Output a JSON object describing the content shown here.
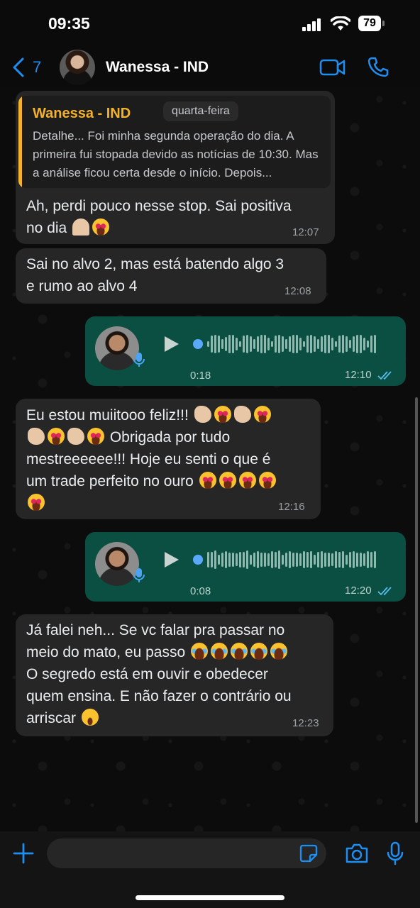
{
  "status_bar": {
    "time": "09:35",
    "battery": "79"
  },
  "header": {
    "back_count": "7",
    "contact_name": "Wanessa - IND"
  },
  "date_separator": "quarta-feira",
  "messages": [
    {
      "direction": "incoming",
      "reply_to": {
        "name": "Wanessa - IND",
        "text": "Detalhe... Foi minha segunda operação do dia. A primeira fui stopada devido as notícias de 10:30. Mas a análise ficou certa desde o início. Depois..."
      },
      "text_lines": [
        "Ah, perdi pouco nesse stop. Sai positiva",
        "no dia"
      ],
      "time": "12:07"
    },
    {
      "direction": "incoming",
      "text_lines": [
        "Sai no alvo 2, mas está batendo algo 3",
        "e rumo ao alvo 4"
      ],
      "time": "12:08"
    },
    {
      "direction": "outgoing",
      "type": "voice",
      "duration": "0:18",
      "time": "12:10",
      "status": "read"
    },
    {
      "direction": "incoming",
      "text_lines": [
        "Eu estou muiitooo feliz!!!",
        "Obrigada por tudo",
        "mestreeeeee!!! Hoje eu senti o que é",
        "um trade perfeito no ouro"
      ],
      "time": "12:16"
    },
    {
      "direction": "outgoing",
      "type": "voice",
      "duration": "0:08",
      "time": "12:20",
      "status": "read"
    },
    {
      "direction": "incoming",
      "text_lines": [
        "Já falei neh... Se vc falar pra passar no",
        "meio do mato, eu passo",
        "O segredo está em ouvir e obedecer",
        "quem ensina. E não fazer o contrário ou",
        "arriscar"
      ],
      "time": "12:23"
    }
  ],
  "input": {
    "placeholder": ""
  },
  "colors": {
    "accent": "#1f8ef1",
    "outgoing_bubble": "#0b4f42",
    "incoming_bubble": "#262626",
    "reply_name": "#f3b22a"
  }
}
